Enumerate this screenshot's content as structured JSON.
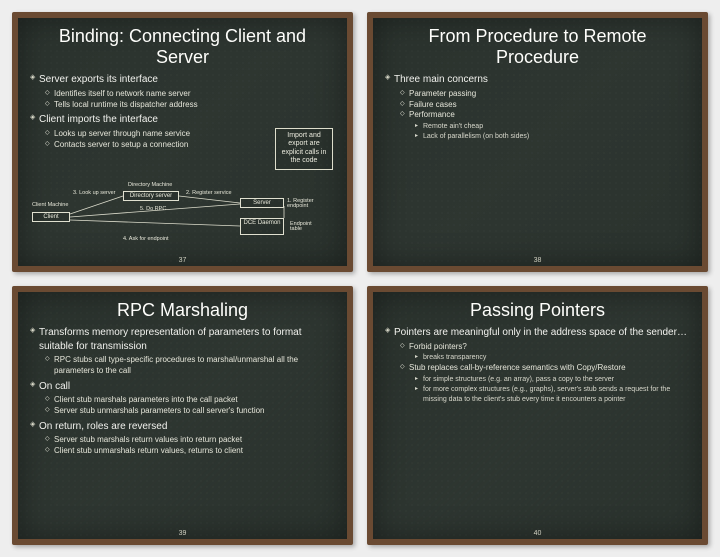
{
  "slides": [
    {
      "page": "37",
      "title": "Binding: Connecting Client and Server",
      "note": "Import and export are explicit calls in the code",
      "items": [
        {
          "t": "Server exports its interface",
          "c": [
            "Identifies itself to network name server",
            "Tells local runtime its dispatcher address"
          ]
        },
        {
          "t": "Client imports the interface",
          "c": [
            "Looks up server through name service",
            "Contacts server to setup a connection"
          ]
        }
      ],
      "diagram": {
        "dir_machine": "Directory Machine",
        "dir_server": "Directory server",
        "client_machine": "Client Machine",
        "client": "Client",
        "server": "Server",
        "dce": "DCE Daemon",
        "endpoint_table": "Endpoint table",
        "l_register_endpoint": "1. Register endpoint",
        "l_register_service": "2. Register service",
        "l_lookup": "3. Look up server",
        "l_ask": "4. Ask for endpoint",
        "l_rpc": "5. Do RPC"
      }
    },
    {
      "page": "38",
      "title": "From Procedure to Remote Procedure",
      "items": [
        {
          "t": "Three main concerns",
          "c": [
            {
              "t": "Parameter passing"
            },
            {
              "t": "Failure cases"
            },
            {
              "t": "Performance",
              "c": [
                "Remote ain't cheap",
                "Lack of parallelism (on both sides)"
              ]
            }
          ]
        }
      ]
    },
    {
      "page": "39",
      "title": "RPC Marshaling",
      "items": [
        {
          "t": "Transforms memory representation of parameters to format suitable for transmission",
          "c": [
            "RPC stubs call type-specific procedures to marshal/unmarshal all the parameters to the call"
          ]
        },
        {
          "t": "On call",
          "c": [
            "Client stub marshals parameters into the call packet",
            "Server stub unmarshals parameters to call server's function"
          ]
        },
        {
          "t": "On return, roles are reversed",
          "c": [
            "Server stub marshals return values into return packet",
            "Client stub unmarshals return values, returns to client"
          ]
        }
      ]
    },
    {
      "page": "40",
      "title": "Passing Pointers",
      "items": [
        {
          "t": "Pointers are meaningful only in the address space of the sender…",
          "c": [
            {
              "t": "Forbid pointers?",
              "c": [
                "breaks transparency"
              ]
            },
            {
              "t": "Stub replaces call-by-reference semantics with Copy/Restore",
              "c": [
                "for simple structures (e.g. an array), pass a copy to the server",
                "for more complex structures (e.g., graphs), server's stub sends a request for the missing data to the client's stub every time it encounters a pointer"
              ]
            }
          ]
        }
      ]
    }
  ]
}
